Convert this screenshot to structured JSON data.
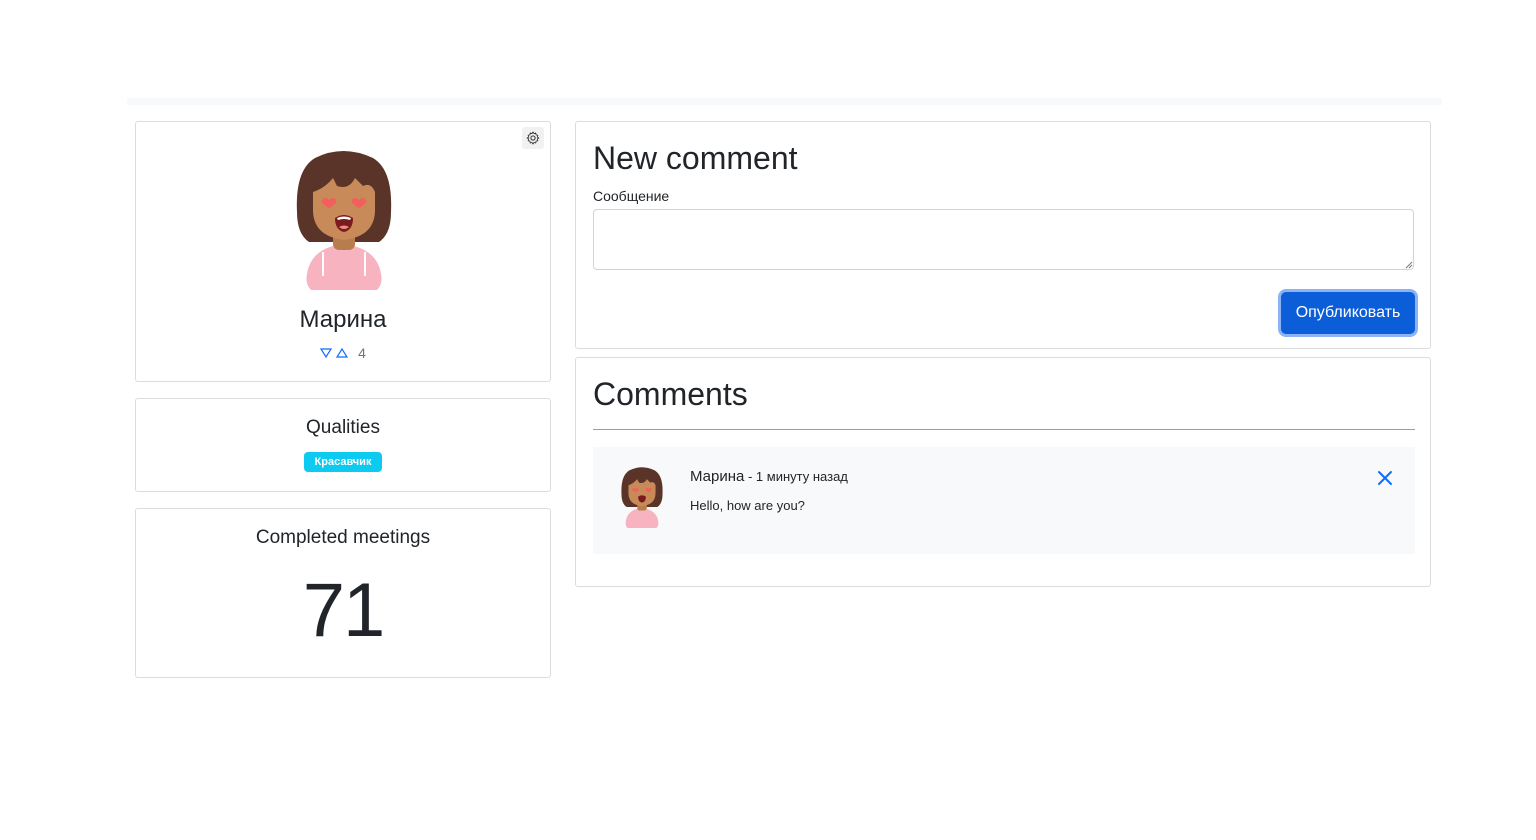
{
  "profile": {
    "name": "Марина",
    "rating": "4",
    "settings_icon": "gear-icon",
    "rate_down_icon": "triangle-down-icon",
    "rate_up_icon": "triangle-up-icon"
  },
  "qualities": {
    "title": "Qualities",
    "badges": [
      {
        "label": "Красавчик",
        "color": "#0dcaf0"
      }
    ]
  },
  "meetings": {
    "title": "Completed meetings",
    "count": "71"
  },
  "new_comment": {
    "title": "New comment",
    "message_label": "Сообщение",
    "message_value": "",
    "submit_label": "Опубликовать"
  },
  "comments": {
    "title": "Comments",
    "items": [
      {
        "author": "Марина",
        "separator": " - ",
        "time": "1 минуту назад",
        "text": "Hello, how are you?",
        "delete_icon": "close-icon"
      }
    ]
  },
  "colors": {
    "primary": "#0b5ed7",
    "info": "#0dcaf0",
    "link": "#0d6efd"
  }
}
